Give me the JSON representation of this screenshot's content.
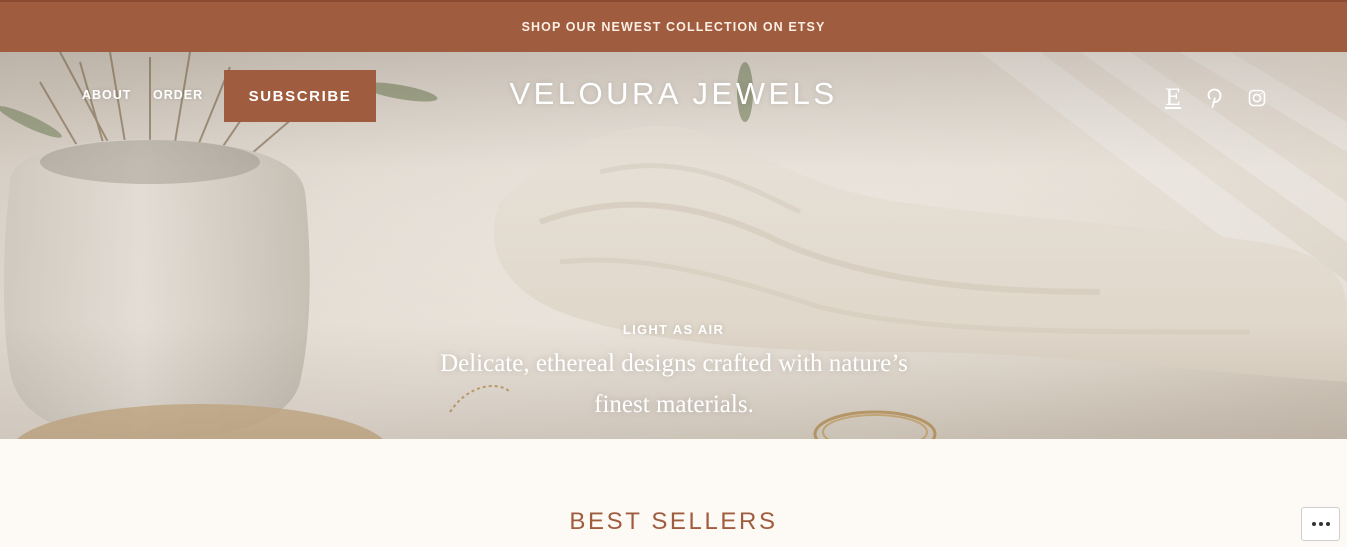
{
  "announcement": {
    "text": "SHOP OUR NEWEST COLLECTION ON ETSY"
  },
  "nav": {
    "about": "ABOUT",
    "order": "ORDER",
    "subscribe": "SUBSCRIBE"
  },
  "site_title": "VELOURA JEWELS",
  "social": {
    "etsy_glyph": "E",
    "icons": [
      "etsy-icon",
      "pinterest-icon",
      "instagram-icon"
    ]
  },
  "hero": {
    "kicker": "LIGHT AS AIR",
    "text": "Delicate, ethereal designs crafted with nature’s finest materials."
  },
  "section": {
    "title": "BEST SELLERS"
  },
  "colors": {
    "accent": "#a05c3e",
    "background": "#fdf9f5",
    "text_light": "#ffffff"
  }
}
